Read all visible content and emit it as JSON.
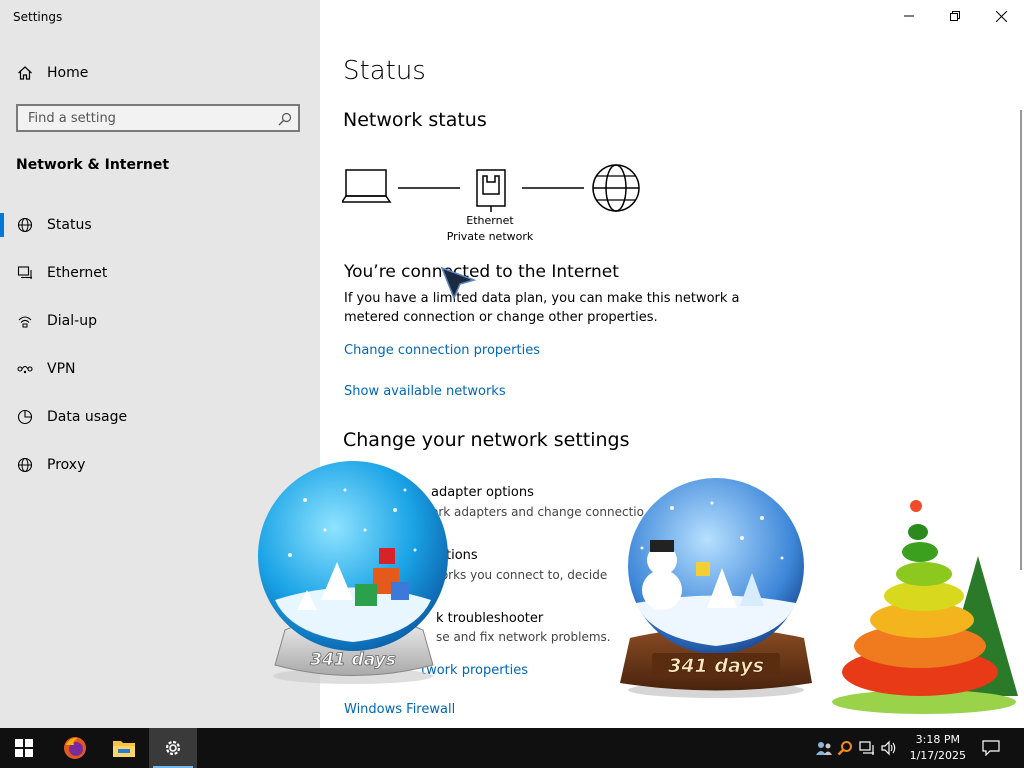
{
  "window": {
    "title": "Settings"
  },
  "sidebar": {
    "home_label": "Home",
    "search_placeholder": "Find a setting",
    "section_title": "Network & Internet",
    "items": [
      {
        "label": "Status",
        "icon": "status-icon",
        "active": true
      },
      {
        "label": "Ethernet",
        "icon": "ethernet-icon"
      },
      {
        "label": "Dial-up",
        "icon": "dialup-icon"
      },
      {
        "label": "VPN",
        "icon": "vpn-icon"
      },
      {
        "label": "Data usage",
        "icon": "data-usage-icon"
      },
      {
        "label": "Proxy",
        "icon": "globe-icon"
      }
    ]
  },
  "main": {
    "title": "Status",
    "network_status_heading": "Network status",
    "adapter_name": "Ethernet",
    "network_type": "Private network",
    "connected_heading": "You’re connected to the Internet",
    "connected_desc": "If you have a limited data plan, you can make this network a metered connection or change other properties.",
    "change_connection_link": "Change connection properties",
    "show_networks_link": "Show available networks",
    "change_settings_heading": "Change your network settings",
    "options": [
      {
        "title": "adapter options",
        "subtitle": "ork adapters and change connectio"
      },
      {
        "title": "tions",
        "subtitle": "works you connect to, decide"
      },
      {
        "title": "k troubleshooter",
        "subtitle": "se and fix network problems."
      }
    ],
    "network_properties_link": "twork properties",
    "firewall_link": "Windows Firewall"
  },
  "overlays": {
    "globe_left_label": "341 days",
    "globe_right_label": "341 days"
  },
  "taskbar": {
    "time": "3:18 PM",
    "date": "1/17/2025"
  },
  "colors": {
    "accent": "#0078d7",
    "link": "#0067b8",
    "sidebar_bg": "#e6e6e6",
    "taskbar_bg": "#101010"
  }
}
